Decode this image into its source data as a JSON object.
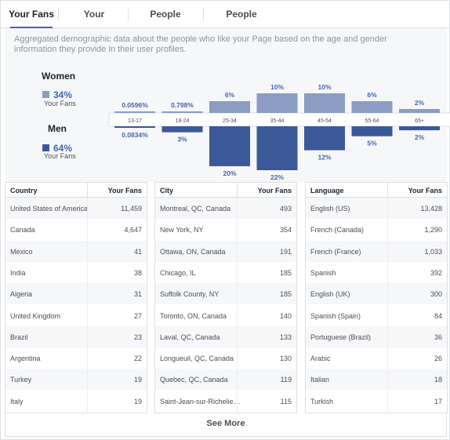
{
  "tabs": [
    {
      "label": "Your Fans"
    },
    {
      "label": "Your Followers"
    },
    {
      "label": "People Reached"
    },
    {
      "label": "People Engaged"
    }
  ],
  "description": "Aggregated demographic data about the people who like your Page based on the age and gender information they provide in their user profiles.",
  "legend": {
    "women": {
      "title": "Women",
      "percent": "34%",
      "sub": "Your Fans",
      "color": "#8b9dc3"
    },
    "men": {
      "title": "Men",
      "percent": "64%",
      "sub": "Your Fans",
      "color": "#3b5998"
    }
  },
  "chart_data": {
    "type": "bar",
    "categories": [
      "13-17",
      "18-24",
      "25-34",
      "35-44",
      "45-54",
      "55-64",
      "65+"
    ],
    "series": [
      {
        "name": "Women",
        "values": [
          0.0596,
          0.798,
          6,
          10,
          10,
          6,
          2
        ],
        "labels": [
          "0.0596%",
          "0.798%",
          "6%",
          "10%",
          "10%",
          "6%",
          "2%"
        ],
        "color": "#8b9dc3"
      },
      {
        "name": "Men",
        "values": [
          0.0834,
          3,
          20,
          22,
          12,
          5,
          2
        ],
        "labels": [
          "0.0834%",
          "3%",
          "20%",
          "22%",
          "12%",
          "5%",
          "2%"
        ],
        "color": "#3b5998"
      }
    ]
  },
  "tables": [
    {
      "header": {
        "name": "Country",
        "value": "Your Fans"
      },
      "rows": [
        {
          "name": "United States of America",
          "value": "11,459"
        },
        {
          "name": "Canada",
          "value": "4,647"
        },
        {
          "name": "Mexico",
          "value": "41"
        },
        {
          "name": "India",
          "value": "38"
        },
        {
          "name": "Algeria",
          "value": "31"
        },
        {
          "name": "United Kingdom",
          "value": "27"
        },
        {
          "name": "Brazil",
          "value": "23"
        },
        {
          "name": "Argentina",
          "value": "22"
        },
        {
          "name": "Turkey",
          "value": "19"
        },
        {
          "name": "Italy",
          "value": "19"
        }
      ]
    },
    {
      "header": {
        "name": "City",
        "value": "Your Fans"
      },
      "rows": [
        {
          "name": "Montreal, QC, Canada",
          "value": "493"
        },
        {
          "name": "New York, NY",
          "value": "354"
        },
        {
          "name": "Ottawa, ON, Canada",
          "value": "191"
        },
        {
          "name": "Chicago, IL",
          "value": "185"
        },
        {
          "name": "Suffolk County, NY",
          "value": "185"
        },
        {
          "name": "Toronto, ON, Canada",
          "value": "140"
        },
        {
          "name": "Laval, QC, Canada",
          "value": "133"
        },
        {
          "name": "Longueuil, QC, Canada",
          "value": "130"
        },
        {
          "name": "Quebec, QC, Canada",
          "value": "119"
        },
        {
          "name": "Saint-Jean-sur-Richelie…",
          "value": "115"
        }
      ]
    },
    {
      "header": {
        "name": "Language",
        "value": "Your Fans"
      },
      "rows": [
        {
          "name": "English (US)",
          "value": "13,428"
        },
        {
          "name": "French (Canada)",
          "value": "1,290"
        },
        {
          "name": "French (France)",
          "value": "1,033"
        },
        {
          "name": "Spanish",
          "value": "392"
        },
        {
          "name": "English (UK)",
          "value": "300"
        },
        {
          "name": "Spanish (Spain)",
          "value": "84"
        },
        {
          "name": "Portuguese (Brazil)",
          "value": "36"
        },
        {
          "name": "Arabic",
          "value": "26"
        },
        {
          "name": "Italian",
          "value": "18"
        },
        {
          "name": "Turkish",
          "value": "17"
        }
      ]
    }
  ],
  "see_more": "See More"
}
